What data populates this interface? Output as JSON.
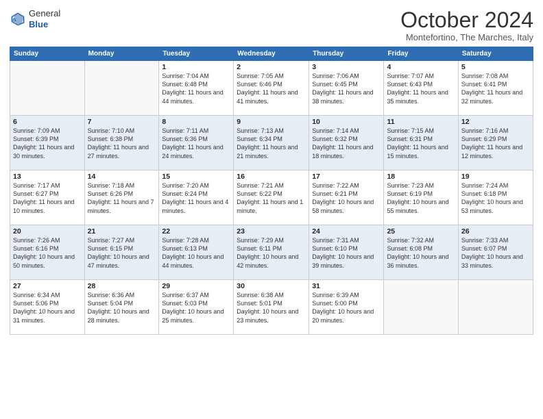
{
  "logo": {
    "line1": "General",
    "line2": "Blue"
  },
  "header": {
    "month": "October 2024",
    "location": "Montefortino, The Marches, Italy"
  },
  "weekdays": [
    "Sunday",
    "Monday",
    "Tuesday",
    "Wednesday",
    "Thursday",
    "Friday",
    "Saturday"
  ],
  "weeks": [
    [
      {
        "day": "",
        "info": ""
      },
      {
        "day": "",
        "info": ""
      },
      {
        "day": "1",
        "info": "Sunrise: 7:04 AM\nSunset: 6:48 PM\nDaylight: 11 hours and 44 minutes."
      },
      {
        "day": "2",
        "info": "Sunrise: 7:05 AM\nSunset: 6:46 PM\nDaylight: 11 hours and 41 minutes."
      },
      {
        "day": "3",
        "info": "Sunrise: 7:06 AM\nSunset: 6:45 PM\nDaylight: 11 hours and 38 minutes."
      },
      {
        "day": "4",
        "info": "Sunrise: 7:07 AM\nSunset: 6:43 PM\nDaylight: 11 hours and 35 minutes."
      },
      {
        "day": "5",
        "info": "Sunrise: 7:08 AM\nSunset: 6:41 PM\nDaylight: 11 hours and 32 minutes."
      }
    ],
    [
      {
        "day": "6",
        "info": "Sunrise: 7:09 AM\nSunset: 6:39 PM\nDaylight: 11 hours and 30 minutes."
      },
      {
        "day": "7",
        "info": "Sunrise: 7:10 AM\nSunset: 6:38 PM\nDaylight: 11 hours and 27 minutes."
      },
      {
        "day": "8",
        "info": "Sunrise: 7:11 AM\nSunset: 6:36 PM\nDaylight: 11 hours and 24 minutes."
      },
      {
        "day": "9",
        "info": "Sunrise: 7:13 AM\nSunset: 6:34 PM\nDaylight: 11 hours and 21 minutes."
      },
      {
        "day": "10",
        "info": "Sunrise: 7:14 AM\nSunset: 6:32 PM\nDaylight: 11 hours and 18 minutes."
      },
      {
        "day": "11",
        "info": "Sunrise: 7:15 AM\nSunset: 6:31 PM\nDaylight: 11 hours and 15 minutes."
      },
      {
        "day": "12",
        "info": "Sunrise: 7:16 AM\nSunset: 6:29 PM\nDaylight: 11 hours and 12 minutes."
      }
    ],
    [
      {
        "day": "13",
        "info": "Sunrise: 7:17 AM\nSunset: 6:27 PM\nDaylight: 11 hours and 10 minutes."
      },
      {
        "day": "14",
        "info": "Sunrise: 7:18 AM\nSunset: 6:26 PM\nDaylight: 11 hours and 7 minutes."
      },
      {
        "day": "15",
        "info": "Sunrise: 7:20 AM\nSunset: 6:24 PM\nDaylight: 11 hours and 4 minutes."
      },
      {
        "day": "16",
        "info": "Sunrise: 7:21 AM\nSunset: 6:22 PM\nDaylight: 11 hours and 1 minute."
      },
      {
        "day": "17",
        "info": "Sunrise: 7:22 AM\nSunset: 6:21 PM\nDaylight: 10 hours and 58 minutes."
      },
      {
        "day": "18",
        "info": "Sunrise: 7:23 AM\nSunset: 6:19 PM\nDaylight: 10 hours and 55 minutes."
      },
      {
        "day": "19",
        "info": "Sunrise: 7:24 AM\nSunset: 6:18 PM\nDaylight: 10 hours and 53 minutes."
      }
    ],
    [
      {
        "day": "20",
        "info": "Sunrise: 7:26 AM\nSunset: 6:16 PM\nDaylight: 10 hours and 50 minutes."
      },
      {
        "day": "21",
        "info": "Sunrise: 7:27 AM\nSunset: 6:15 PM\nDaylight: 10 hours and 47 minutes."
      },
      {
        "day": "22",
        "info": "Sunrise: 7:28 AM\nSunset: 6:13 PM\nDaylight: 10 hours and 44 minutes."
      },
      {
        "day": "23",
        "info": "Sunrise: 7:29 AM\nSunset: 6:11 PM\nDaylight: 10 hours and 42 minutes."
      },
      {
        "day": "24",
        "info": "Sunrise: 7:31 AM\nSunset: 6:10 PM\nDaylight: 10 hours and 39 minutes."
      },
      {
        "day": "25",
        "info": "Sunrise: 7:32 AM\nSunset: 6:08 PM\nDaylight: 10 hours and 36 minutes."
      },
      {
        "day": "26",
        "info": "Sunrise: 7:33 AM\nSunset: 6:07 PM\nDaylight: 10 hours and 33 minutes."
      }
    ],
    [
      {
        "day": "27",
        "info": "Sunrise: 6:34 AM\nSunset: 5:06 PM\nDaylight: 10 hours and 31 minutes."
      },
      {
        "day": "28",
        "info": "Sunrise: 6:36 AM\nSunset: 5:04 PM\nDaylight: 10 hours and 28 minutes."
      },
      {
        "day": "29",
        "info": "Sunrise: 6:37 AM\nSunset: 5:03 PM\nDaylight: 10 hours and 25 minutes."
      },
      {
        "day": "30",
        "info": "Sunrise: 6:38 AM\nSunset: 5:01 PM\nDaylight: 10 hours and 23 minutes."
      },
      {
        "day": "31",
        "info": "Sunrise: 6:39 AM\nSunset: 5:00 PM\nDaylight: 10 hours and 20 minutes."
      },
      {
        "day": "",
        "info": ""
      },
      {
        "day": "",
        "info": ""
      }
    ]
  ]
}
